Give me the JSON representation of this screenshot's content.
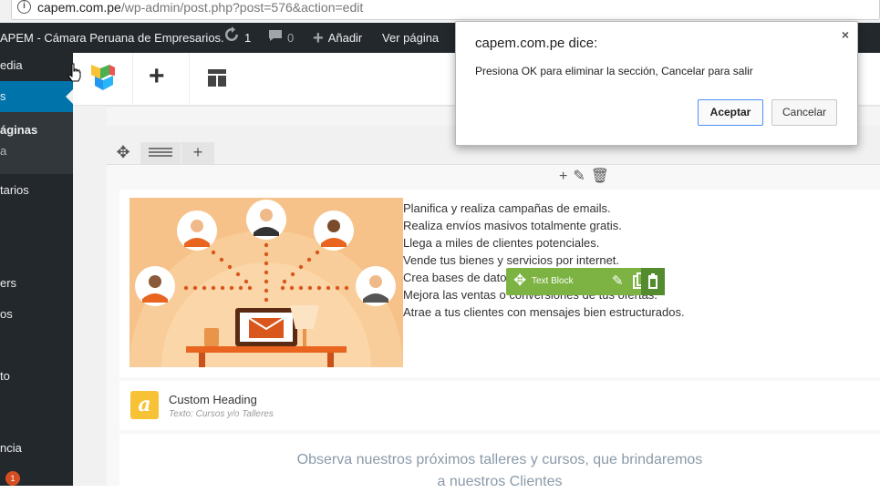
{
  "browser": {
    "url_host": "capem.com.pe",
    "url_path": "/wp-admin/post.php?post=576&action=edit"
  },
  "admin_bar": {
    "site_name": "APEM - Cámara Peruana de Empresarios.",
    "updates_count": "1",
    "comments_count": "0",
    "add_new_label": "Añadir",
    "view_page_label": "Ver página"
  },
  "sidebar": {
    "items": [
      {
        "label": "edia"
      },
      {
        "label": "s"
      },
      {
        "label": "áginas"
      },
      {
        "label": "a"
      },
      {
        "label": "tarios"
      },
      {
        "label": "ers"
      },
      {
        "label": "os"
      },
      {
        "label": "to"
      },
      {
        "label": "ncia"
      }
    ],
    "badge_count": "1"
  },
  "editor": {
    "text_block_lines": [
      "Planifica y realiza campañas de emails.",
      "Realiza envíos masivos totalmente gratis.",
      "Llega a miles de clientes potenciales.",
      "Vende tus bienes y servicios por internet.",
      "Crea bases de datos",
      "Mejora las ventas o conversiones de tus ofertas.",
      "Atrae a tus clientes con mensajes bien estructurados."
    ],
    "text_block_toolbar_label": "Text Block",
    "custom_heading_title": "Custom Heading",
    "custom_heading_subtitle": "Texto: Cursos y/o Talleres",
    "observa_line1": "Observa nuestros próximos talleres y cursos, que brindaremos",
    "observa_line2": "a nuestros Clientes"
  },
  "dialog": {
    "title": "capem.com.pe dice:",
    "message": "Presiona OK para eliminar la sección, Cancelar para salir",
    "ok_label": "Aceptar",
    "cancel_label": "Cancelar",
    "close_symbol": "×"
  },
  "colors": {
    "admin_bar_bg": "#23282d",
    "active_menu": "#0073aa",
    "vc_green": "#7cb342",
    "heading_icon": "#f7c235"
  }
}
